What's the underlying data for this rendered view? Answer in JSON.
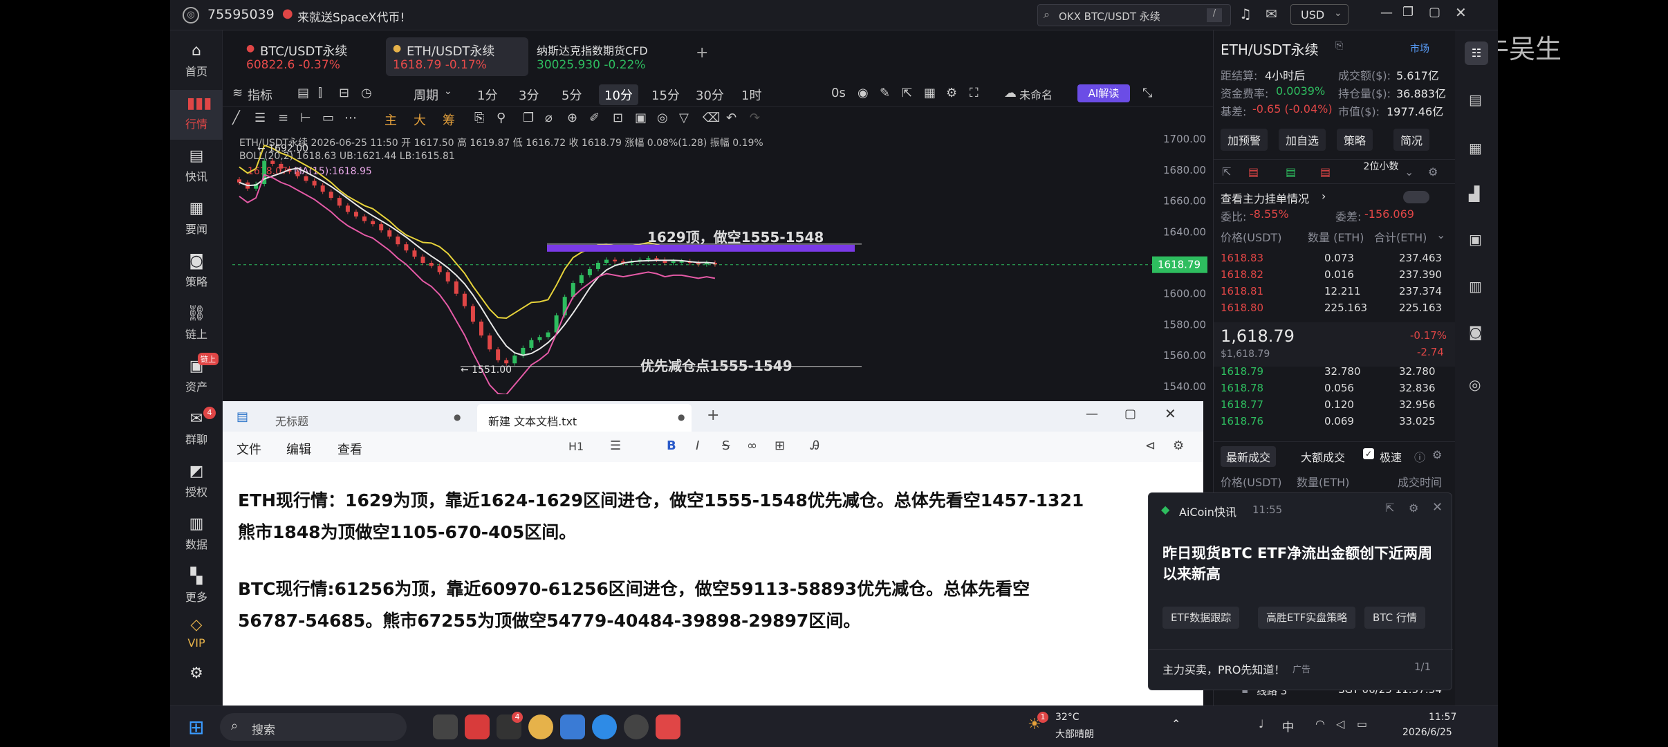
{
  "titlebar": {
    "user_id": "75595039",
    "promo": "来就送SpaceX代币!",
    "search": "OKX BTC/USDT 永续",
    "search_key": "/",
    "currency": "USD"
  },
  "watermark": "@亿牛吴生",
  "nav": [
    {
      "label": "首页",
      "icon": "home-icon"
    },
    {
      "label": "行情",
      "icon": "chart-icon",
      "active": true
    },
    {
      "label": "快讯",
      "icon": "news-icon"
    },
    {
      "label": "要闻",
      "icon": "doc-icon"
    },
    {
      "label": "策略",
      "icon": "robot-icon"
    },
    {
      "label": "链上",
      "icon": "chain-icon"
    },
    {
      "label": "资产",
      "icon": "wallet-icon",
      "badge": "链上"
    },
    {
      "label": "群聊",
      "icon": "chat-icon",
      "badge": "4"
    },
    {
      "label": "授权",
      "icon": "auth-icon"
    },
    {
      "label": "数据",
      "icon": "data-icon"
    },
    {
      "label": "更多",
      "icon": "more-icon"
    },
    {
      "label": "VIP",
      "icon": "vip-icon"
    },
    {
      "label": "",
      "icon": "settings-icon"
    }
  ],
  "tabs": [
    {
      "name": "BTC/USDT永续",
      "price": "60822.6 -0.37%",
      "color": "#e64a4a"
    },
    {
      "name": "ETH/USDT永续",
      "price": "1618.79 -0.17%",
      "color": "#e64a4a"
    },
    {
      "name": "纳斯达克指数期货CFD",
      "price": "30025.930 -0.22%",
      "color": "#2ebd5f"
    }
  ],
  "toolbar": {
    "indicator": "指标",
    "period": "周期",
    "periods": [
      "1分",
      "3分",
      "5分",
      "10分",
      "15分",
      "30分",
      "1时"
    ],
    "selected": "10分",
    "zero": "0s",
    "unnamed": "未命名",
    "ai": "AI解读"
  },
  "drawbar": {
    "items": [
      "主",
      "大",
      "筹"
    ]
  },
  "chart_info": {
    "line1": "ETH/USDT永续  2026-06-25 11:50  开 1617.50  高 1619.87  低 1616.72  收 1618.79  涨幅 0.08%(1.28)  振幅 0.19%",
    "boll": "BOLL(20,2)  1618.63  UB:1621.44  LB:1615.81",
    "ma": "MA(15):1618.95",
    "ma_partial": "1618.07"
  },
  "chart_data": {
    "type": "candlestick",
    "ylim": [
      1535,
      1705
    ],
    "yticks": [
      1700,
      1680,
      1660,
      1640,
      1620,
      1600,
      1580,
      1560,
      1540
    ],
    "current_price": "1618.79",
    "high_label": "1692.00",
    "low_label": "1551.00",
    "annotations": [
      {
        "text": "1629顶，做空1555-1548",
        "price": 1629
      },
      {
        "text": "优先减仓点1555-1549",
        "price": 1553
      }
    ],
    "close": [
      1672,
      1668,
      1671,
      1686,
      1684,
      1681,
      1679,
      1676,
      1673,
      1670,
      1666,
      1662,
      1657,
      1653,
      1650,
      1647,
      1645,
      1641,
      1637,
      1632,
      1628,
      1624,
      1620,
      1618,
      1614,
      1608,
      1600,
      1592,
      1582,
      1573,
      1564,
      1557,
      1555,
      1560,
      1565,
      1570,
      1572,
      1575,
      1586,
      1598,
      1607,
      1612,
      1616,
      1620,
      1622,
      1621,
      1620,
      1621,
      1622,
      1623,
      1622,
      1620,
      1621,
      1621,
      1620,
      1619,
      1620,
      1619
    ]
  },
  "notepad": {
    "tabs": [
      "无标题",
      "新建 文本文档.txt"
    ],
    "menu": [
      "文件",
      "编辑",
      "查看"
    ],
    "heading": "H1",
    "lines": [
      "ETH现行情：1629为顶，靠近1624-1629区间进仓，做空1555-1548优先减仓。总体先看空1457-1321",
      "熊市1848为顶做空1105-670-405区间。",
      "BTC现行情:61256为顶，靠近60970-61256区间进仓，做空59113-58893优先减仓。总体先看空",
      "56787-54685。熊市67255为顶做空54779-40484-39898-29897区间。"
    ]
  },
  "right": {
    "pair": "ETH/USDT永续",
    "spot": "市场",
    "settle": "距结算:",
    "settle_v": "4小时后",
    "vol": "成交额($):",
    "vol_v": "5.617亿",
    "fund": "资金费率:",
    "fund_v": "0.0039%",
    "oi": "持仓量($):",
    "oi_v": "36.883亿",
    "basis": "基差:",
    "basis_v": "-0.65 (-0.04%)",
    "mcap": "市值($):",
    "mcap_v": "1977.46亿",
    "buttons": [
      "加预警",
      "加自选",
      "策略",
      "简况"
    ],
    "depth": "2位小数",
    "main_orders": "查看主力挂单情况",
    "ratio_l": "委比:",
    "ratio_v": "-8.55%",
    "diff_l": "委差:",
    "diff_v": "-156.069",
    "head": [
      "价格(USDT)",
      "数量 (ETH)",
      "合计(ETH)"
    ],
    "asks": [
      [
        "1618.83",
        "0.073",
        "237.463"
      ],
      [
        "1618.82",
        "0.016",
        "237.390"
      ],
      [
        "1618.81",
        "12.211",
        "237.374"
      ],
      [
        "1618.80",
        "225.163",
        "225.163"
      ]
    ],
    "last": "1,618.79",
    "last_usd": "$1,618.79",
    "chg": "-0.17%",
    "chg_v": "-2.74",
    "bids": [
      [
        "1618.79",
        "32.780",
        "32.780"
      ],
      [
        "1618.78",
        "0.056",
        "32.836"
      ],
      [
        "1618.77",
        "0.120",
        "32.956"
      ],
      [
        "1618.76",
        "0.069",
        "33.025"
      ]
    ],
    "trade_tabs": [
      "最新成交",
      "大额成交",
      "极速"
    ],
    "trade_head": [
      "价格(USDT)",
      "数量(ETH)",
      "成交时间"
    ],
    "status": "线路 3",
    "clock_text": "SGT 06/25 11:57:54"
  },
  "popup": {
    "title": "AiCoin快讯",
    "time": "11:55",
    "headline": "昨日现货BTC ETF净流出金额创下近两周以来新高",
    "chips": [
      "ETF数据跟踪",
      "高胜ETF实盘策略",
      "BTC 行情"
    ],
    "footer": "主力买卖，PRO先知道！",
    "ad": "广告",
    "page": "1/1"
  },
  "taskbar": {
    "search": "搜索",
    "weather": "32°C",
    "weather_desc": "大部晴朗",
    "ime": "中",
    "time": "11:57",
    "date": "2026/6/25",
    "badge": "4",
    "weather_badge": "1"
  }
}
